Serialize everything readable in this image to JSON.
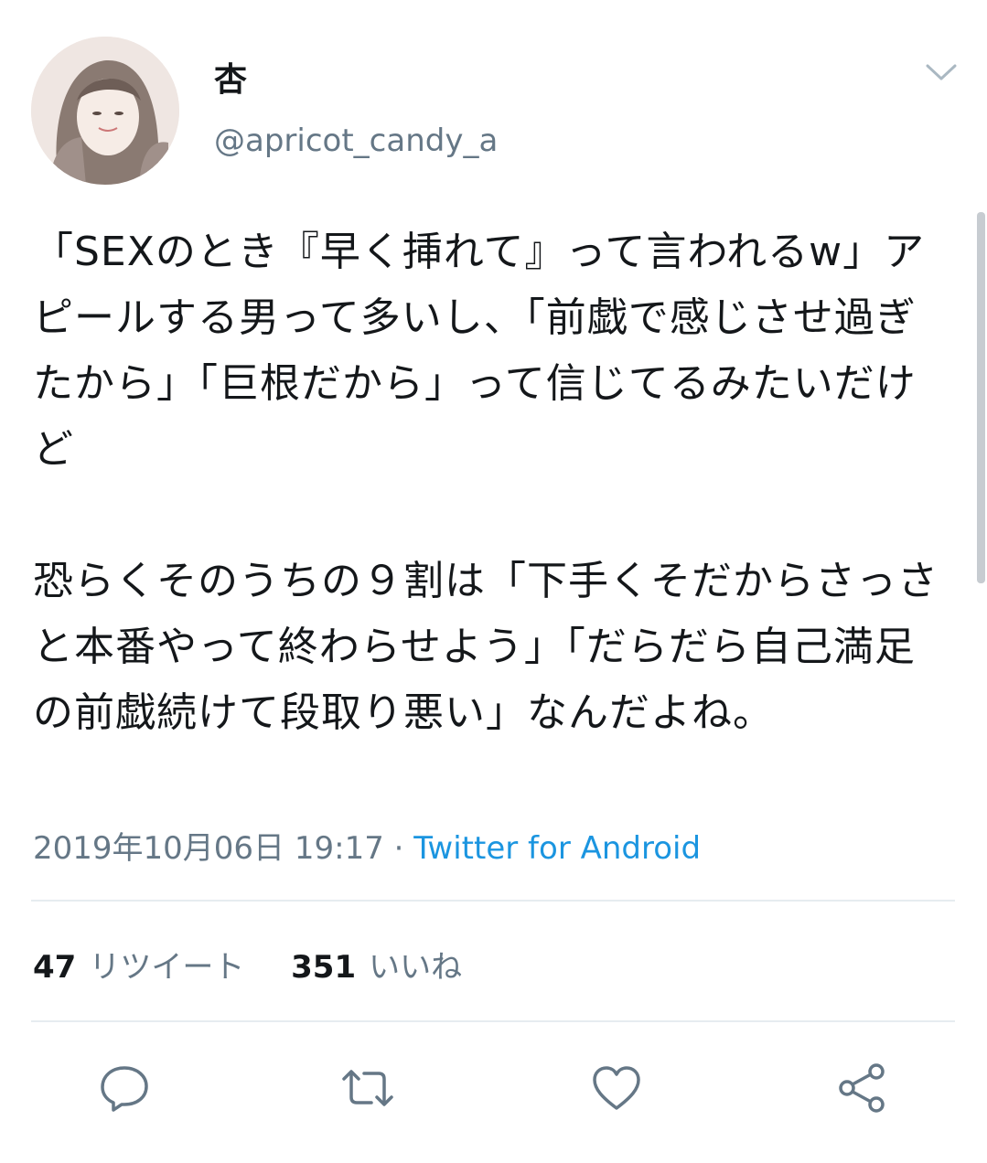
{
  "user": {
    "display_name": "杏",
    "handle": "@apricot_candy_a"
  },
  "tweet": {
    "text": "「SEXのとき『早く挿れて』って言われるw」アピールする男って多いし、「前戯で感じさせ過ぎたから」「巨根だから」って信じてるみたいだけど\n\n恐らくそのうちの９割は「下手くそだからさっさと本番やって終わらせよう」「だらだら自己満足の前戯続けて段取り悪い」なんだよね。",
    "timestamp": "2019年10月06日 19:17 · ",
    "source": "Twitter for Android"
  },
  "stats": {
    "retweets_count": "47",
    "retweets_label": "リツイート",
    "likes_count": "351",
    "likes_label": "いいね"
  },
  "icons": {
    "menu": "chevron-down-icon",
    "reply": "reply-icon",
    "retweet": "retweet-icon",
    "like": "heart-icon",
    "share": "share-icon"
  },
  "colors": {
    "link": "#1b95e0",
    "secondary_text": "#657786",
    "divider": "#e6ecf0"
  }
}
